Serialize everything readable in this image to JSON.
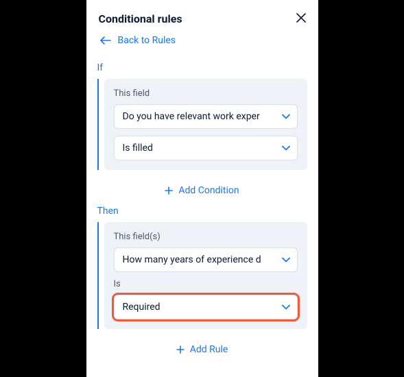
{
  "header": {
    "title": "Conditional rules"
  },
  "back": {
    "label": "Back to Rules"
  },
  "if": {
    "section_label": "If",
    "this_field_label": "This field",
    "field_select": "Do you have relevant work exper",
    "operator_select": "Is filled",
    "add_condition_label": "Add Condition"
  },
  "then": {
    "section_label": "Then",
    "this_fields_label": "This field(s)",
    "field_select": "How many years of experience d",
    "is_label": "Is",
    "is_select": "Required",
    "add_rule_label": "Add Rule"
  }
}
